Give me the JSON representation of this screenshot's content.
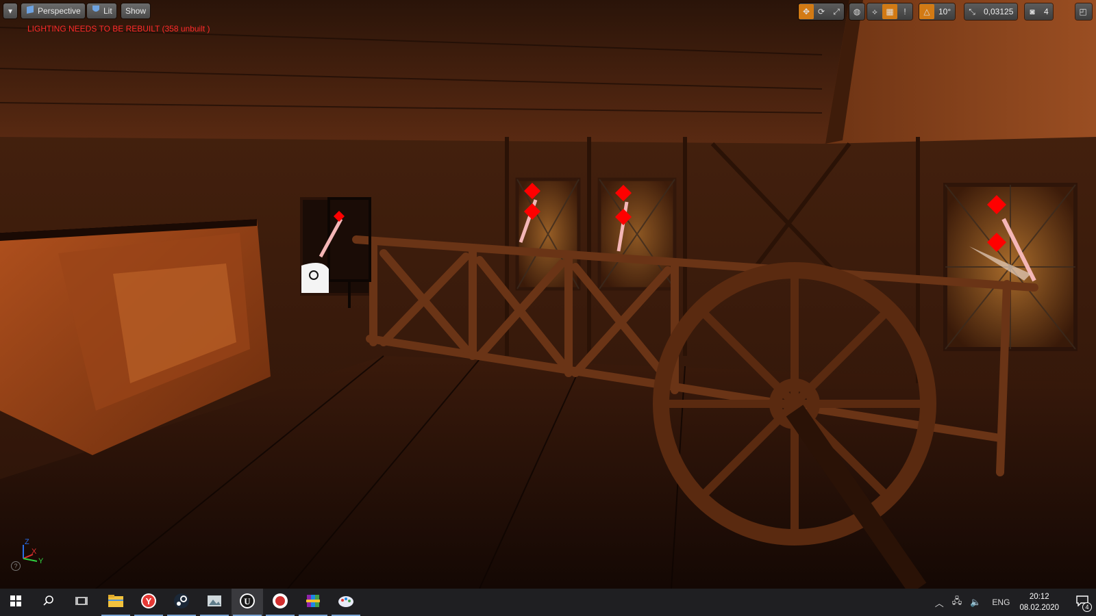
{
  "viewport": {
    "menu_arrow": "▾",
    "perspective_label": "Perspective",
    "lit_label": "Lit",
    "show_label": "Show",
    "lighting_warning": "LIGHTING NEEDS TO BE REBUILT (358 unbuilt )",
    "lighting_subtext": "",
    "toolbar_right": {
      "rotation_snap": "10°",
      "scale_snap": "0,03125",
      "camera_speed": "4"
    },
    "axis": {
      "x": "X",
      "y": "Y",
      "z": "Z"
    },
    "help_icon": "?"
  },
  "taskbar": {
    "apps": [
      {
        "name": "start-icon",
        "label": "Start"
      },
      {
        "name": "search-icon",
        "label": "Search"
      },
      {
        "name": "task-view-icon",
        "label": "Task View"
      },
      {
        "name": "file-explorer-icon",
        "label": "File Explorer"
      },
      {
        "name": "yandex-browser-icon",
        "label": "Yandex Browser"
      },
      {
        "name": "steam-icon",
        "label": "Steam"
      },
      {
        "name": "photos-icon",
        "label": "Photos"
      },
      {
        "name": "unreal-engine-icon",
        "label": "Unreal Engine"
      },
      {
        "name": "screen-recorder-icon",
        "label": "Recorder"
      },
      {
        "name": "winrar-icon",
        "label": "WinRAR"
      },
      {
        "name": "paint-icon",
        "label": "Paint"
      }
    ],
    "language": "ENG",
    "time": "20:12",
    "date": "08.02.2020",
    "notifications": "4"
  },
  "colors": {
    "warning": "#ff2a2a",
    "accent_active": "#d27a14",
    "taskbar_bg": "#1f1f22"
  }
}
